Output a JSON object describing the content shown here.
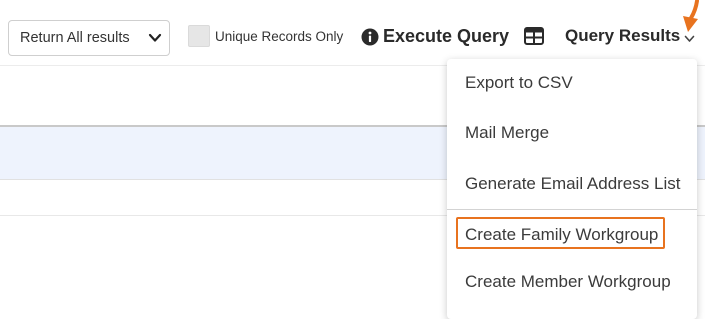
{
  "toolbar": {
    "results_filter": {
      "selected": "Return All results",
      "icon": "chevron-down-icon"
    },
    "unique_records_label": "Unique Records Only",
    "execute_query_label": "Execute Query",
    "execute_query_icon": "info-circle-icon",
    "table_view_icon": "table-grid-icon",
    "query_results_label": "Query Results",
    "query_results_icon": "caret-down-icon"
  },
  "menu": {
    "items": [
      {
        "label": "Export to CSV"
      },
      {
        "label": "Mail Merge"
      },
      {
        "label": "Generate Email Address List"
      },
      {
        "label": "Create Family Workgroup",
        "highlighted": true
      },
      {
        "label": "Create Member Workgroup"
      }
    ]
  },
  "colors": {
    "accent": "#e8731f",
    "row_highlight": "#eef3fd",
    "text": "#2b2b2b"
  }
}
